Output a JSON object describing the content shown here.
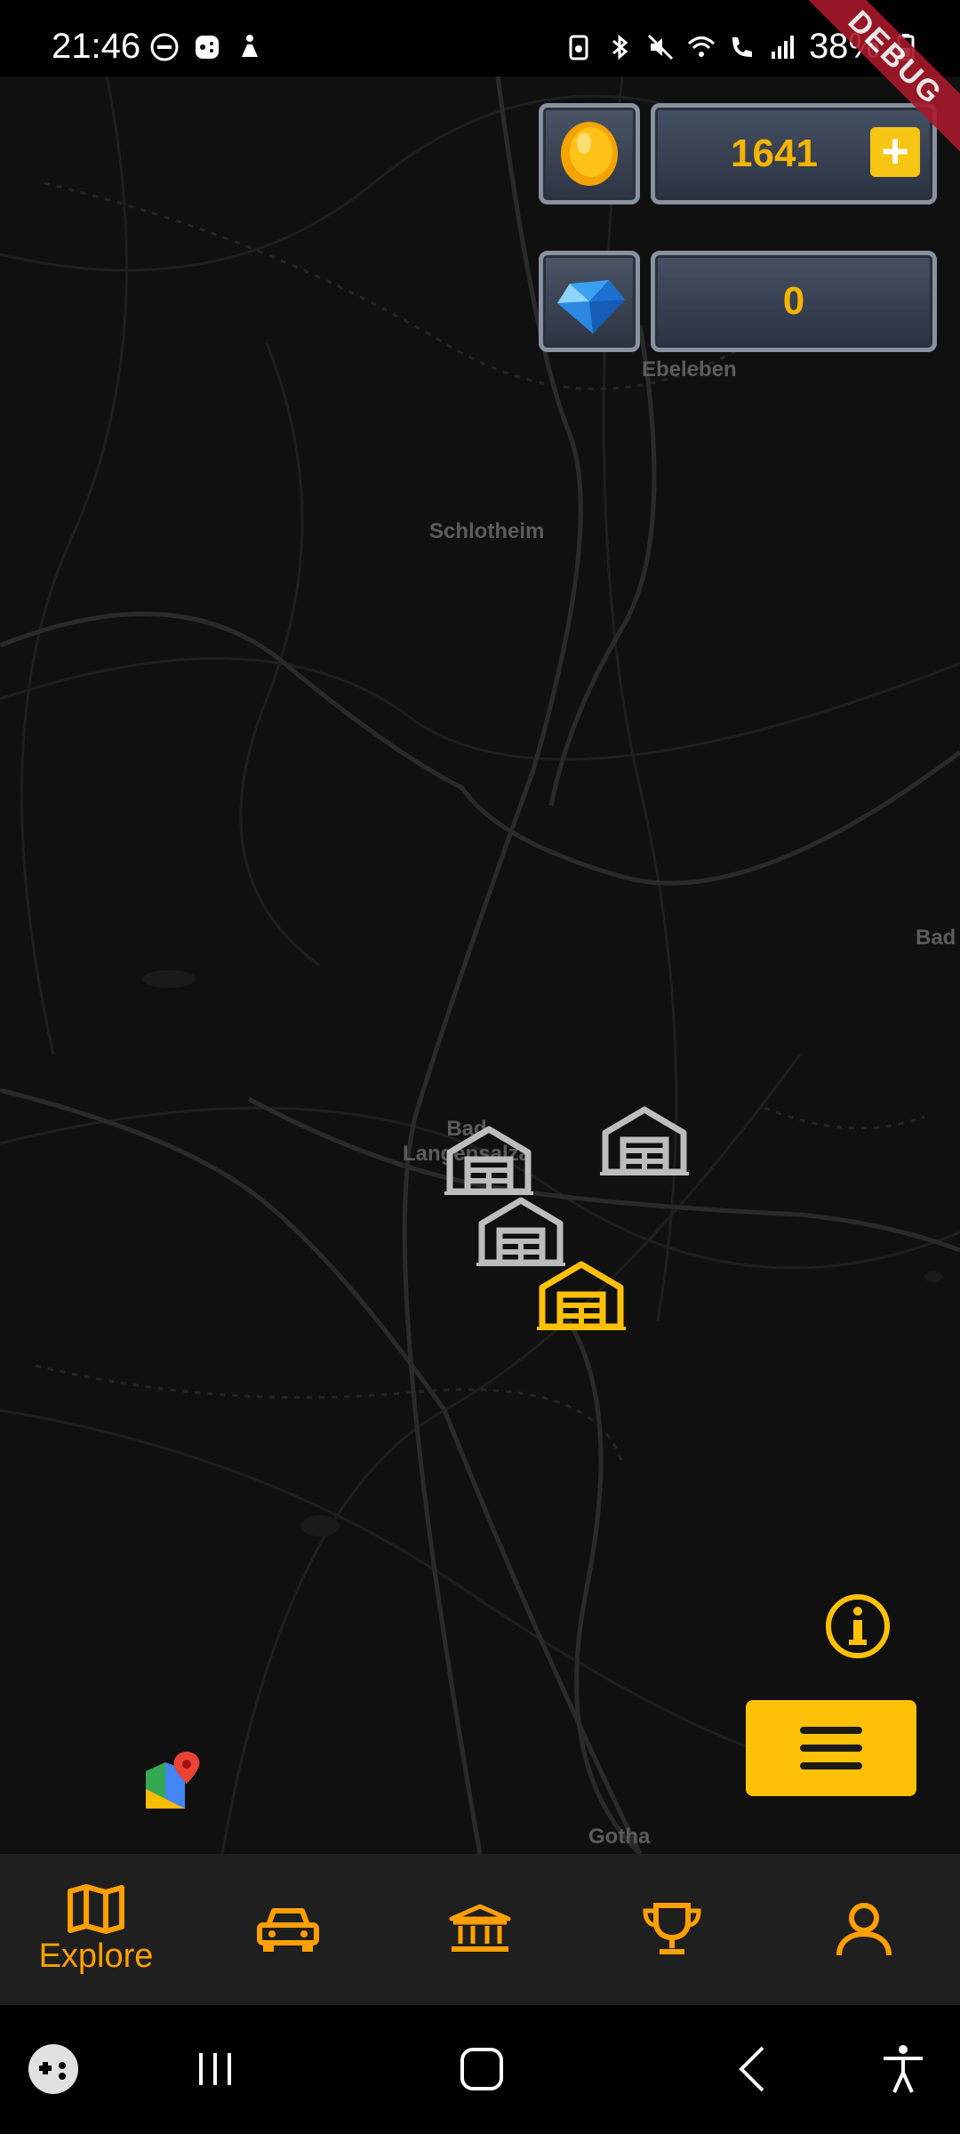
{
  "status_bar": {
    "time": "21:46",
    "battery_percent": "38%"
  },
  "debug_banner": "DEBUG",
  "map": {
    "labels": [
      "Ebeleben",
      "Schlotheim",
      "Bad",
      "Bad Langensalza",
      "Gotha"
    ],
    "marker_colors": {
      "default": "#bdbdbd",
      "selected": "#ffc107"
    }
  },
  "currency": {
    "coins": "1641",
    "coin_icon": "gold-coin-icon",
    "gems": "0",
    "gem_icon": "blue-diamond-icon",
    "add_label": "+"
  },
  "bottom_nav": {
    "items": [
      {
        "label": "Explore",
        "icon": "map-icon",
        "active": true
      },
      {
        "label": "",
        "icon": "car-icon",
        "active": false
      },
      {
        "label": "",
        "icon": "bank-icon",
        "active": false
      },
      {
        "label": "",
        "icon": "trophy-icon",
        "active": false
      },
      {
        "label": "",
        "icon": "profile-icon",
        "active": false
      }
    ]
  },
  "colors": {
    "accent": "#ffa000",
    "button_yellow": "#ffc107",
    "currency_text": "#f5b400"
  }
}
